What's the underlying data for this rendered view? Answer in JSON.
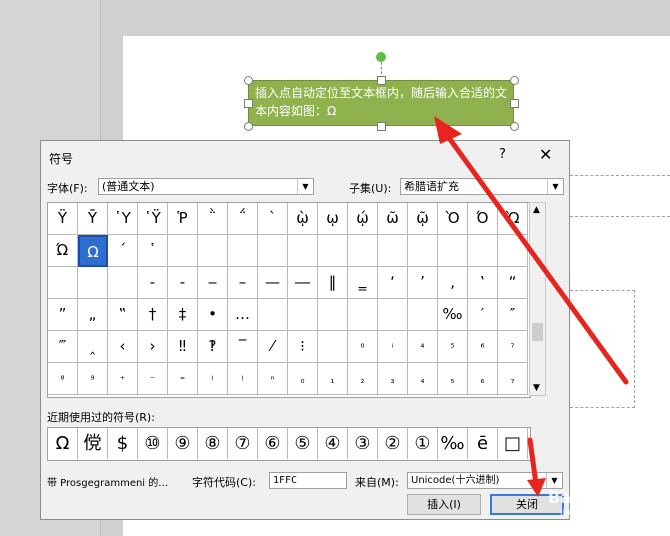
{
  "shape": {
    "text": "插入点自动定位至文本框内，随后输入合适的文本内容如图：Ω"
  },
  "dialog": {
    "title": "符号",
    "help": "?",
    "close": "✕",
    "font_label": "字体(F):",
    "font_value": "(普通文本)",
    "subset_label": "子集(U):",
    "subset_value": "希腊语扩充",
    "recent_label": "近期使用过的符号(R):",
    "char_name": "带 Prosgegrammeni 的…",
    "code_label": "字符代码(C):",
    "code_value": "1FFC",
    "from_label": "来自(M):",
    "from_value": "Unicode(十六进制)",
    "insert_label": "插入(I)",
    "close_label": "关闭"
  },
  "grid": [
    [
      "Ÿ",
      "Ȳ",
      "῾Y",
      "῾Ÿ",
      "Ῥ",
      "῭",
      "΅",
      "`",
      "ῲ",
      "ῳ",
      "ῴ",
      "ῶ",
      "ῷ",
      "Ὸ",
      "Ό",
      "Ὼ"
    ],
    [
      "Ώ",
      "Ω",
      "´",
      "῾",
      "",
      "",
      "",
      "",
      "",
      "",
      "",
      "",
      "",
      "",
      "",
      ""
    ],
    [
      "",
      "",
      "",
      "‐",
      "‑",
      "‒",
      "–",
      "—",
      "―",
      "‖",
      "‗",
      "‘",
      "’",
      "‚",
      "‛",
      "“"
    ],
    [
      "”",
      "„",
      "‟",
      "†",
      "‡",
      "•",
      "…",
      "",
      "",
      "",
      "",
      "",
      "",
      "‰",
      "′",
      "″"
    ],
    [
      "‴",
      "‸",
      "‹",
      "›",
      "‼",
      "‽",
      "‾",
      "⁄",
      "⁝",
      "",
      "⁰",
      "ⁱ",
      "⁴",
      "⁵",
      "⁶",
      "⁷"
    ],
    [
      "⁸",
      "⁹",
      "⁺",
      "⁻",
      "⁼",
      "⁽",
      "⁾",
      "ⁿ",
      "₀",
      "₁",
      "₂",
      "₃",
      "₄",
      "₅",
      "₆",
      "₇"
    ]
  ],
  "recent": [
    "Ω",
    "傥",
    "$",
    "⑩",
    "⑨",
    "⑧",
    "⑦",
    "⑥",
    "⑤",
    "④",
    "③",
    "②",
    "①",
    "‰",
    "ē",
    "□"
  ],
  "watermark": {
    "text": "Baidu经验",
    "url": "jingyan.baidu.com"
  }
}
